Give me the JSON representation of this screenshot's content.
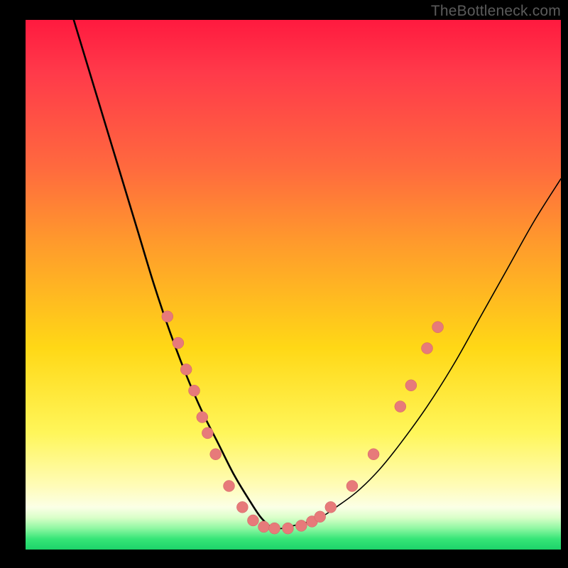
{
  "watermark": {
    "text": "TheBottleneck.com"
  },
  "colors": {
    "curve_stroke": "#000000",
    "marker_fill": "#e77a7a",
    "marker_stroke": "#d16363"
  },
  "chart_data": {
    "type": "line",
    "title": "",
    "xlabel": "",
    "ylabel": "",
    "xlim": [
      0,
      100
    ],
    "ylim": [
      0,
      100
    ],
    "grid": false,
    "legend": false,
    "note": "Values estimated from pixel positions; no axis ticks or numeric labels are present in the image.",
    "series": [
      {
        "name": "right-branch",
        "x": [
          46,
          48,
          50,
          52,
          55,
          58,
          62,
          66,
          70,
          75,
          80,
          85,
          90,
          95,
          100
        ],
        "y": [
          4,
          4,
          4.5,
          5,
          6,
          8,
          11,
          15,
          20,
          27,
          35,
          44,
          53,
          62,
          70
        ]
      },
      {
        "name": "left-branch",
        "x": [
          9,
          12,
          15,
          18,
          21,
          24,
          27,
          30,
          33,
          36,
          39,
          42,
          44,
          46
        ],
        "y": [
          100,
          90,
          80,
          70,
          60,
          50,
          41,
          33,
          26,
          20,
          14,
          9,
          6,
          4
        ]
      }
    ],
    "markers": [
      {
        "branch": "left",
        "x": 26.5,
        "y": 44
      },
      {
        "branch": "left",
        "x": 28.5,
        "y": 39
      },
      {
        "branch": "left",
        "x": 30.0,
        "y": 34
      },
      {
        "branch": "left",
        "x": 31.5,
        "y": 30
      },
      {
        "branch": "left",
        "x": 33.0,
        "y": 25
      },
      {
        "branch": "left",
        "x": 34.0,
        "y": 22
      },
      {
        "branch": "left",
        "x": 35.5,
        "y": 18
      },
      {
        "branch": "left",
        "x": 38.0,
        "y": 12
      },
      {
        "branch": "left",
        "x": 40.5,
        "y": 8
      },
      {
        "branch": "left",
        "x": 42.5,
        "y": 5.5
      },
      {
        "branch": "left",
        "x": 44.5,
        "y": 4.3
      },
      {
        "branch": "left",
        "x": 46.5,
        "y": 4
      },
      {
        "branch": "right",
        "x": 49.0,
        "y": 4
      },
      {
        "branch": "right",
        "x": 51.5,
        "y": 4.5
      },
      {
        "branch": "right",
        "x": 53.5,
        "y": 5.3
      },
      {
        "branch": "right",
        "x": 55.0,
        "y": 6.2
      },
      {
        "branch": "right",
        "x": 57.0,
        "y": 8
      },
      {
        "branch": "right",
        "x": 61.0,
        "y": 12
      },
      {
        "branch": "right",
        "x": 65.0,
        "y": 18
      },
      {
        "branch": "right",
        "x": 70.0,
        "y": 27
      },
      {
        "branch": "right",
        "x": 72.0,
        "y": 31
      },
      {
        "branch": "right",
        "x": 75.0,
        "y": 38
      },
      {
        "branch": "right",
        "x": 77.0,
        "y": 42
      }
    ]
  }
}
